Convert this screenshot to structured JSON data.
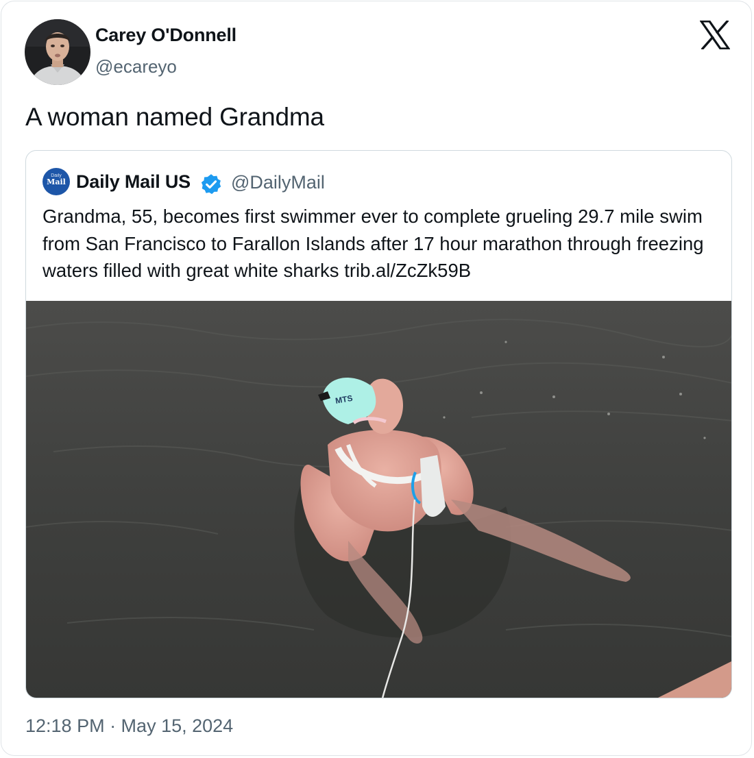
{
  "tweet": {
    "author_name": "Carey O'Donnell",
    "author_handle": "@ecareyo",
    "text": "A woman named Grandma",
    "timestamp": "12:18 PM · May 15, 2024",
    "platform_icon": "x-logo-icon"
  },
  "quoted_tweet": {
    "author_name": "Daily Mail US",
    "author_handle": "@DailyMail",
    "verified": true,
    "verified_color": "#1d9bf0",
    "avatar_logo_small": "Daily",
    "avatar_logo_big": "Mail",
    "text": "Grandma, 55, becomes first swimmer ever to complete grueling 29.7 mile swim from San Francisco to Farallon Islands after 17 hour marathon through freezing waters filled with great white sharks ",
    "link": "trib.al/ZcZk59B",
    "swim_cap_text": "MTS"
  },
  "colors": {
    "text_primary": "#0f1419",
    "text_secondary": "#536471",
    "border": "#cfd9de",
    "brand_blue": "#1d56a8"
  }
}
